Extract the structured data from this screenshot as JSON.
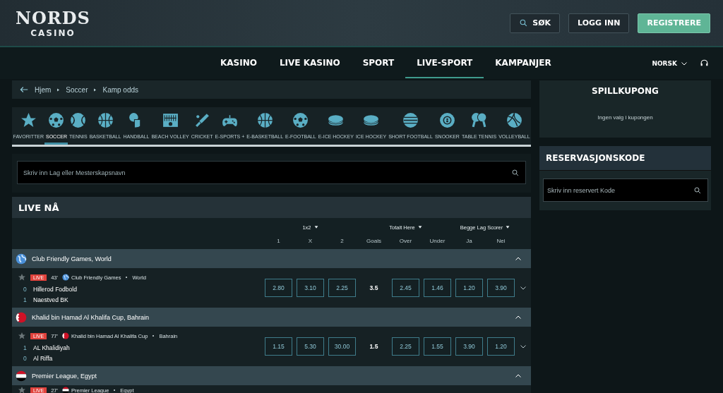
{
  "header": {
    "logo": {
      "title": "NORDS",
      "subtitle": "CASINO"
    },
    "buttons": [
      {
        "label": "SØK",
        "kind": "search"
      },
      {
        "label": "LOGG INN",
        "kind": "outline"
      },
      {
        "label": "REGISTRERE",
        "kind": "primary"
      }
    ]
  },
  "nav": {
    "items": [
      {
        "label": "KASINO",
        "selected": false
      },
      {
        "label": "LIVE KASINO",
        "selected": false
      },
      {
        "label": "SPORT",
        "selected": false
      },
      {
        "label": "LIVE-SPORT",
        "selected": true
      },
      {
        "label": "KAMPANJER",
        "selected": false
      }
    ],
    "language": "NORSK"
  },
  "breadcrumb": [
    "Hjem",
    "Soccer",
    "Kamp odds"
  ],
  "sports": [
    {
      "label": "FAVORITTER",
      "selected": false
    },
    {
      "label": "SOCCER",
      "selected": true
    },
    {
      "label": "TENNIS",
      "selected": false
    },
    {
      "label": "BASKETBALL",
      "selected": false
    },
    {
      "label": "HANDBALL",
      "selected": false
    },
    {
      "label": "BEACH VOLLEY",
      "selected": false
    },
    {
      "label": "CRICKET",
      "selected": false
    },
    {
      "label": "E-SPORTS +",
      "selected": false
    },
    {
      "label": "E-BASKETBALL",
      "selected": false
    },
    {
      "label": "E-FOOTBALL",
      "selected": false
    },
    {
      "label": "E-ICE HOCKEY",
      "selected": false
    },
    {
      "label": "ICE HOCKEY",
      "selected": false
    },
    {
      "label": "SHORT FOOTBALL",
      "selected": false
    },
    {
      "label": "SNOOKER",
      "selected": false
    },
    {
      "label": "TABLE TENNIS",
      "selected": false
    },
    {
      "label": "VOLLEYBALL",
      "selected": false
    }
  ],
  "search": {
    "placeholder": "Skriv inn Lag eller Mesterskapsnavn"
  },
  "live": {
    "title": "LIVE NÅ",
    "markets": [
      {
        "label": "1x2",
        "columns": [
          "1",
          "X",
          "2"
        ]
      },
      {
        "label": "Totalt Here",
        "columns": [
          "Goals",
          "Over",
          "Under"
        ]
      },
      {
        "label": "Begge Lag Scorer",
        "columns": [
          "Ja",
          "Nei"
        ]
      }
    ],
    "groups": [
      {
        "name": "Club Friendly Games, World",
        "expanded": true,
        "matches": [
          {
            "badge": "LIVE",
            "minute": "43'",
            "league": "Club Friendly Games",
            "region": "World",
            "expanded": false,
            "teams": [
              {
                "score": "0",
                "name": "Hillerod Fodbold"
              },
              {
                "score": "1",
                "name": "Naestved BK"
              }
            ],
            "odds": [
              "2.80",
              "3.10",
              "2.25"
            ],
            "line": "3.5",
            "odds2": [
              "2.45",
              "1.46",
              "1.20",
              "3.90"
            ]
          }
        ]
      },
      {
        "name": "Khalid bin Hamad Al Khalifa Cup, Bahrain",
        "expanded": true,
        "matches": [
          {
            "badge": "LIVE",
            "minute": "77'",
            "league": "Khalid bin Hamad Al Khalifa Cup",
            "region": "Bahrain",
            "expanded": false,
            "teams": [
              {
                "score": "1",
                "name": "AL Khalidiyah"
              },
              {
                "score": "0",
                "name": "Al Riffa"
              }
            ],
            "odds": [
              "1.15",
              "5.30",
              "30.00"
            ],
            "line": "1.5",
            "odds2": [
              "2.25",
              "1.55",
              "3.90",
              "1.20"
            ]
          }
        ]
      },
      {
        "name": "Premier League, Egypt",
        "expanded": true,
        "matches": [
          {
            "badge": "LIVE",
            "minute": "27'",
            "league": "Premier League",
            "region": "Egypt"
          }
        ]
      }
    ]
  },
  "slip": {
    "title": "SPILLKUPONG",
    "empty": "Ingen valg i kupongen"
  },
  "reservation": {
    "title": "RESERVASJONSKODE",
    "placeholder": "Skriv inn reservert Kode"
  }
}
